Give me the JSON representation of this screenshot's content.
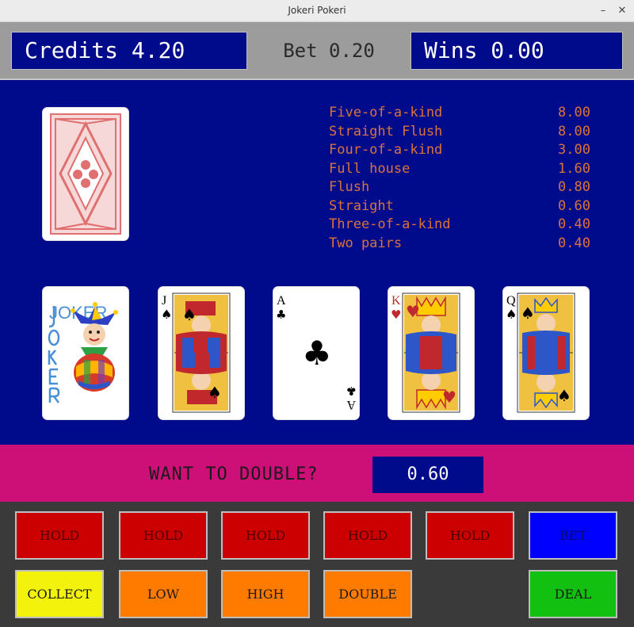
{
  "window": {
    "title": "Jokeri Pokeri",
    "minimize": "–",
    "close": "✕"
  },
  "credits": {
    "label": "Credits",
    "value": "4.20"
  },
  "bet": {
    "label": "Bet",
    "value": "0.20"
  },
  "wins": {
    "label": "Wins",
    "value": "0.00"
  },
  "paytable": [
    {
      "hand": "Five-of-a-kind",
      "payout": "8.00"
    },
    {
      "hand": "Straight Flush",
      "payout": "8.00"
    },
    {
      "hand": "Four-of-a-kind",
      "payout": "3.00"
    },
    {
      "hand": "Full house",
      "payout": "1.60"
    },
    {
      "hand": "Flush",
      "payout": "0.80"
    },
    {
      "hand": "Straight",
      "payout": "0.60"
    },
    {
      "hand": "Three-of-a-kind",
      "payout": "0.40"
    },
    {
      "hand": "Two pairs",
      "payout": "0.40"
    }
  ],
  "cards": [
    {
      "rank": "JOKER",
      "suit": ""
    },
    {
      "rank": "J",
      "suit": "♠"
    },
    {
      "rank": "A",
      "suit": "♣"
    },
    {
      "rank": "K",
      "suit": "♥"
    },
    {
      "rank": "Q",
      "suit": "♠"
    }
  ],
  "double": {
    "prompt": "WANT TO DOUBLE?",
    "value": "0.60"
  },
  "buttons": {
    "hold": "HOLD",
    "bet": "BET",
    "collect": "COLLECT",
    "low": "LOW",
    "high": "HIGH",
    "double": "DOUBLE",
    "deal": "DEAL"
  },
  "colors": {
    "table_blue": "#000b8c",
    "paytable_text": "#d9733b",
    "double_bar": "#cc1077",
    "hold_red": "#cc0000"
  }
}
